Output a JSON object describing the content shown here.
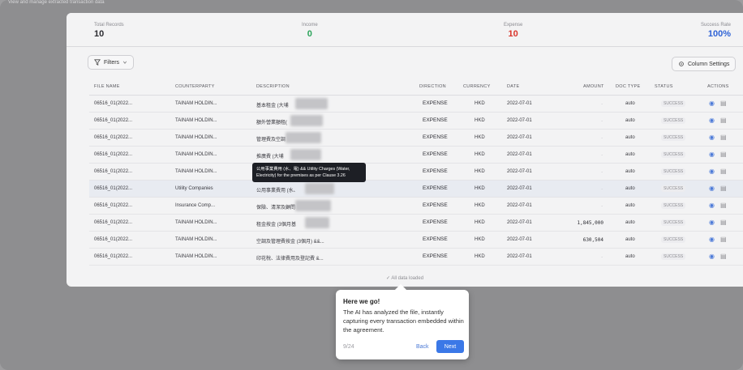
{
  "page": {
    "subtitle": "View and manage extracted transaction data"
  },
  "stats": [
    {
      "label": "Total Records",
      "value": "10",
      "color": "#2b2b30"
    },
    {
      "label": "Income",
      "value": "0",
      "color": "#2aa35a"
    },
    {
      "label": "Expense",
      "value": "10",
      "color": "#d9342b"
    },
    {
      "label": "Success Rate",
      "value": "100%",
      "color": "#2f63d6"
    }
  ],
  "toolbar": {
    "filters_label": "Filters",
    "column_settings_label": "Column Settings"
  },
  "table": {
    "headers": [
      "FILE NAME",
      "COUNTERPARTY",
      "DESCRIPTION",
      "DIRECTION",
      "CURRENCY",
      "DATE",
      "AMOUNT",
      "DOC TYPE",
      "STATUS",
      "ACTIONS"
    ],
    "rows": [
      {
        "file": "06516_01(2022...",
        "party": "TAINAM HOLDIN...",
        "desc": "基本租金 (大埔",
        "direction": "EXPENSE",
        "currency": "HKD",
        "date": "2022-07-01",
        "amount": "-",
        "doctype": "auto",
        "status": "SUCCESS"
      },
      {
        "file": "06516_01(2022...",
        "party": "TAINAM HOLDIN...",
        "desc": "額外營業額租(",
        "direction": "EXPENSE",
        "currency": "HKD",
        "date": "2022-07-01",
        "amount": "-",
        "doctype": "auto",
        "status": "SUCCESS"
      },
      {
        "file": "06516_01(2022...",
        "party": "TAINAM HOLDIN...",
        "desc": "管理費及空調",
        "direction": "EXPENSE",
        "currency": "HKD",
        "date": "2022-07-01",
        "amount": "-",
        "doctype": "auto",
        "status": "SUCCESS"
      },
      {
        "file": "06516_01(2022...",
        "party": "TAINAM HOLDIN...",
        "desc": "推廣費 (大埔",
        "direction": "EXPENSE",
        "currency": "HKD",
        "date": "2022-07-01",
        "amount": "-",
        "doctype": "auto",
        "status": "SUCCESS"
      },
      {
        "file": "06516_01(2022...",
        "party": "TAINAM HOLDIN...",
        "desc": "",
        "direction": "EXPENSE",
        "currency": "HKD",
        "date": "2022-07-01",
        "amount": "-",
        "doctype": "auto",
        "status": "SUCCESS"
      },
      {
        "file": "06516_01(2022...",
        "party": "Utility Companies",
        "desc": "公用事業費用 (水、",
        "direction": "EXPENSE",
        "currency": "HKD",
        "date": "2022-07-01",
        "amount": "-",
        "doctype": "auto",
        "status": "SUCCESS"
      },
      {
        "file": "06516_01(2022...",
        "party": "Insurance Comp...",
        "desc": "保險、清潔及顧問",
        "direction": "EXPENSE",
        "currency": "HKD",
        "date": "2022-07-01",
        "amount": "-",
        "doctype": "auto",
        "status": "SUCCESS"
      },
      {
        "file": "06516_01(2022...",
        "party": "TAINAM HOLDIN...",
        "desc": "租金按金 (3個月基",
        "direction": "EXPENSE",
        "currency": "HKD",
        "date": "2022-07-01",
        "amount": "1,845,000",
        "doctype": "auto",
        "status": "SUCCESS"
      },
      {
        "file": "06516_01(2022...",
        "party": "TAINAM HOLDIN...",
        "desc": "空調及管理費按金 (3個月) &&...",
        "direction": "EXPENSE",
        "currency": "HKD",
        "date": "2022-07-01",
        "amount": "630,504",
        "doctype": "auto",
        "status": "SUCCESS"
      },
      {
        "file": "06516_01(2022...",
        "party": "TAINAM HOLDIN...",
        "desc": "印花稅、法律費用及登記費 &...",
        "direction": "EXPENSE",
        "currency": "HKD",
        "date": "2022-07-01",
        "amount": "-",
        "doctype": "auto",
        "status": "SUCCESS"
      }
    ]
  },
  "footer": {
    "note": "✓ All data loaded"
  },
  "tooltip": {
    "text": "公用事業費用 (水、電) && Utility Charges (Water, Electricity) for the premises as per Clause 3.26"
  },
  "tour": {
    "title": "Here we go!",
    "body": "The AI has analyzed the file, instantly capturing every transaction embedded within the agreement.",
    "step": "9/24",
    "back_label": "Back",
    "next_label": "Next"
  },
  "icons": {
    "filter": "filter-icon",
    "settings": "gear-icon",
    "view": "eye-icon",
    "document": "document-icon",
    "chevron": "chevron-down-icon"
  }
}
